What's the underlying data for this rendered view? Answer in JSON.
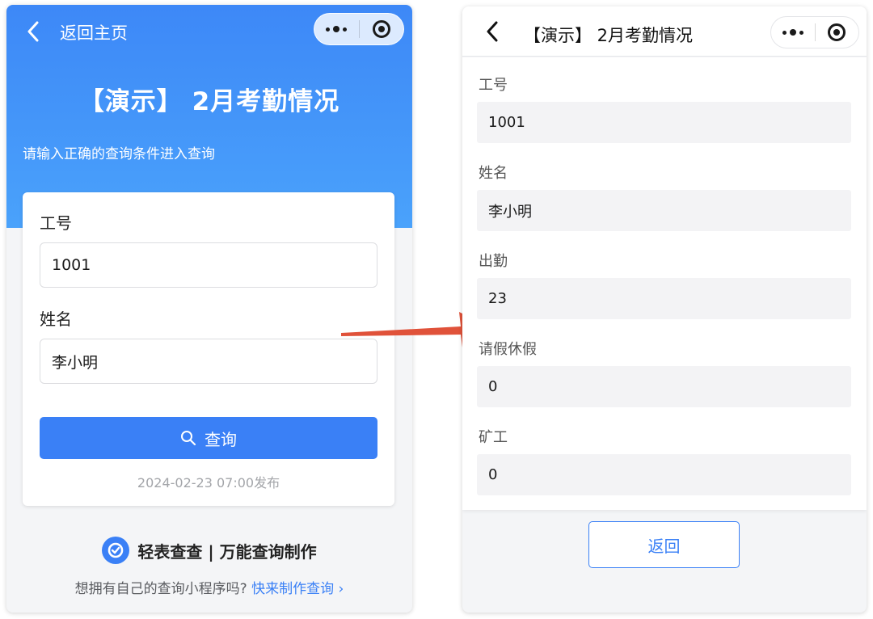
{
  "left": {
    "nav": {
      "back_label": "返回主页"
    },
    "hero": {
      "title": "【演示】 2月考勤情况",
      "subtitle": "请输入正确的查询条件进入查询"
    },
    "form": {
      "fields": [
        {
          "label": "工号",
          "value": "1001"
        },
        {
          "label": "姓名",
          "value": "李小明"
        }
      ],
      "query_button": "查询",
      "publish_info": "2024-02-23 07:00发布"
    },
    "footer": {
      "brand": "轻表查查 | 万能查询制作",
      "promo_text": "想拥有自己的查询小程序吗?",
      "promo_link": "快来制作查询 ›"
    }
  },
  "right": {
    "nav": {
      "title": "【演示】 2月考勤情况"
    },
    "results": [
      {
        "label": "工号",
        "value": "1001"
      },
      {
        "label": "姓名",
        "value": "李小明"
      },
      {
        "label": "出勤",
        "value": "23"
      },
      {
        "label": "请假休假",
        "value": "0"
      },
      {
        "label": "矿工",
        "value": "0"
      }
    ],
    "back_button": "返回"
  },
  "colors": {
    "primary": "#3a80f6",
    "hero_top": "#3d88f7",
    "hero_bottom": "#4aa2fb",
    "arrow": "#e0523a"
  },
  "icons": {
    "back": "chevron-left-icon",
    "more": "more-dots-icon",
    "close": "target-circle-icon",
    "search": "search-icon",
    "brand": "brand-logo-icon",
    "arrow": "red-arrow"
  }
}
